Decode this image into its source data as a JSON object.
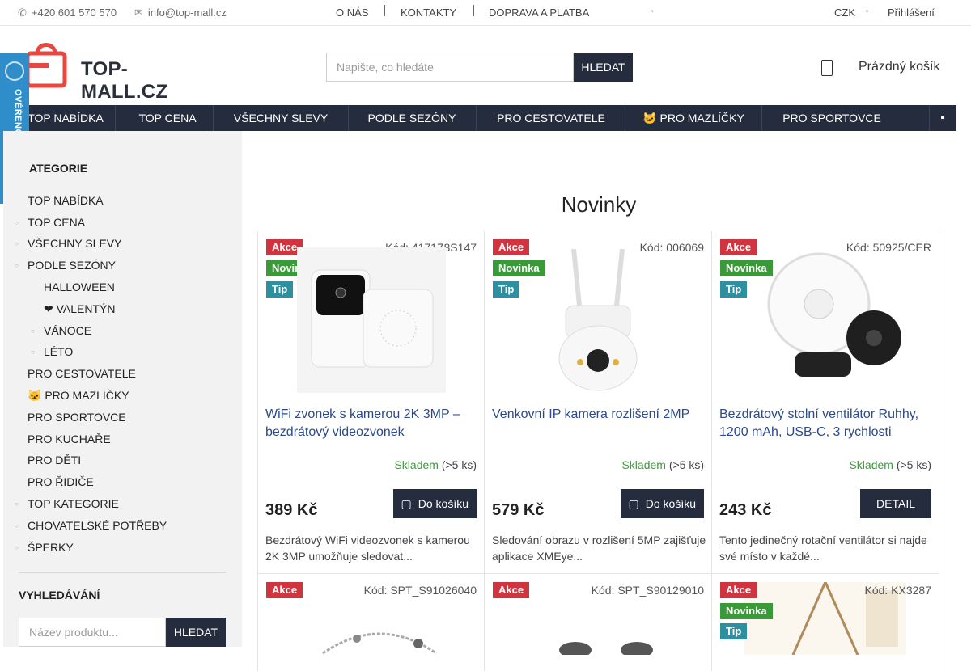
{
  "topbar": {
    "phone": "+420 601 570 570",
    "email": "info@top-mall.cz",
    "links": [
      "O NÁS",
      "KONTAKTY",
      "DOPRAVA A PLATBA"
    ],
    "currency": "CZK",
    "login": "Přihlášení",
    "phone_icon": "phone-icon",
    "email_icon": "envelope-icon"
  },
  "header": {
    "logo_text": "TOP-MALL.CZ",
    "search_placeholder": "Napište, co hledáte",
    "search_button": "HLEDAT",
    "cart_label": "Prázdný košík"
  },
  "nav": {
    "items": [
      "TOP NABÍDKA",
      " TOP CENA",
      " VŠECHNY SLEVY",
      " PODLE SEZÓNY",
      " PRO CESTOVATELE",
      "🐱 PRO MAZLÍČKY",
      " PRO SPORTOVCE"
    ]
  },
  "widget": {
    "label": "OVĚŘENO ZÁKAZNÍKY"
  },
  "sidebar": {
    "categories_title": "KATEGORIE",
    "categories_title_visible": "ATEGORIE",
    "categories": [
      {
        "label": "TOP NABÍDKA",
        "level": 0,
        "bullet": false
      },
      {
        "label": " TOP CENA",
        "level": 0,
        "bullet": true
      },
      {
        "label": " VŠECHNY SLEVY",
        "level": 0,
        "bullet": true
      },
      {
        "label": " PODLE SEZÓNY",
        "level": 0,
        "bullet": true
      },
      {
        "label": " HALLOWEEN",
        "level": 1,
        "bullet": false
      },
      {
        "label": "❤ VALENTÝN",
        "level": 1,
        "bullet": false
      },
      {
        "label": " VÁNOCE",
        "level": 1,
        "bullet": true
      },
      {
        "label": " LÉTO",
        "level": 1,
        "bullet": true
      },
      {
        "label": " PRO CESTOVATELE",
        "level": 0,
        "bullet": false
      },
      {
        "label": "🐱 PRO MAZLÍČKY",
        "level": 0,
        "bullet": false
      },
      {
        "label": " PRO SPORTOVCE",
        "level": 0,
        "bullet": false
      },
      {
        "label": " PRO KUCHAŘE",
        "level": 0,
        "bullet": false
      },
      {
        "label": " PRO DĚTI",
        "level": 0,
        "bullet": false
      },
      {
        "label": " PRO ŘIDIČE",
        "level": 0,
        "bullet": false
      },
      {
        "label": "TOP KATEGORIE",
        "level": 0,
        "bullet": true
      },
      {
        "label": "CHOVATELSKÉ POTŘEBY",
        "level": 0,
        "bullet": true
      },
      {
        "label": "ŠPERKY",
        "level": 0,
        "bullet": true
      }
    ],
    "search_title": "VYHLEDÁVÁNÍ",
    "search_placeholder": "Název produktu...",
    "search_button": "HLEDAT"
  },
  "main": {
    "title": "Novinky",
    "products": [
      {
        "flags": [
          "Akce",
          "Novinka",
          "Tip"
        ],
        "code": "Kód: 4171Z8S147",
        "name": "WiFi zvonek s kamerou 2K 3MP – bezdrátový videozvonek",
        "stock_status": "Skladem",
        "stock_count": "(>5 ks)",
        "price": "389 Kč",
        "button": "Do košíku",
        "description": "Bezdrátový WiFi videozvonek s kamerou 2K 3MP umožňuje sledovat...",
        "image_icon": "doorbell-camera-image"
      },
      {
        "flags": [
          "Akce",
          "Novinka",
          "Tip"
        ],
        "code": "Kód: 006069",
        "name": "Venkovní IP kamera rozlišení 2MP",
        "stock_status": "Skladem",
        "stock_count": "(>5 ks)",
        "price": "579 Kč",
        "button": "Do košíku",
        "description": "Sledování obrazu v rozlišení 5MP zajišťuje aplikace XMEye...",
        "image_icon": "ip-camera-image"
      },
      {
        "flags": [
          "Akce",
          "Novinka",
          "Tip"
        ],
        "code": "Kód: 50925/CER",
        "name": "Bezdrátový stolní ventilátor Ruhhy, 1200 mAh, USB-C, 3 rychlosti",
        "stock_status": "Skladem",
        "stock_count": "(>5 ks)",
        "price": "243 Kč",
        "button": "DETAIL",
        "description": "Tento jedinečný rotační ventilátor si najde své místo v každé...",
        "image_icon": "desk-fan-image"
      },
      {
        "flags": [
          "Akce"
        ],
        "code": "Kód: SPT_S91026040",
        "image_icon": "bracelet-image"
      },
      {
        "flags": [
          "Akce"
        ],
        "code": "Kód: SPT_S90129010",
        "image_icon": "jewelry-image"
      },
      {
        "flags": [
          "Akce",
          "Novinka",
          "Tip"
        ],
        "code": "Kód: KX3287",
        "image_icon": "hanging-chair-image"
      }
    ]
  }
}
